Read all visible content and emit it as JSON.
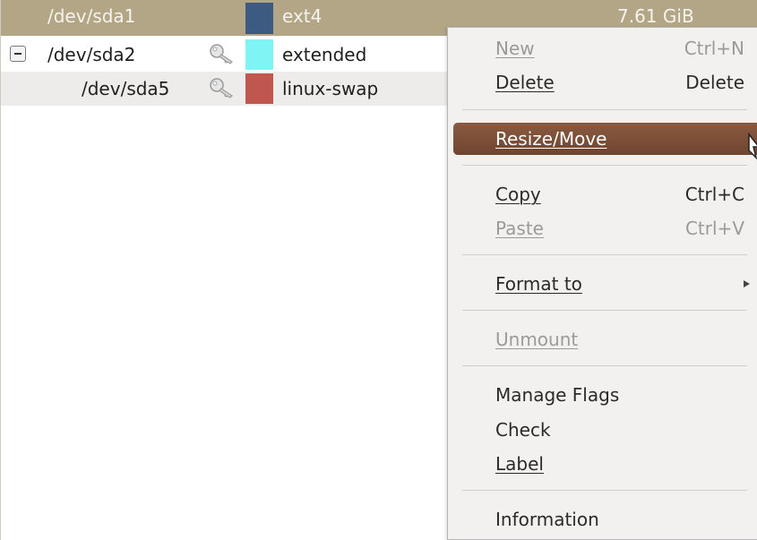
{
  "partitions": [
    {
      "name": "/dev/sda1",
      "filesystem": "ext4",
      "size": "7.61 GiB",
      "color": "#3d5a80",
      "locked": false,
      "selected": true
    },
    {
      "name": "/dev/sda2",
      "filesystem": "extended",
      "color": "#7ef4f4",
      "locked": true,
      "expanded": true
    },
    {
      "name": "/dev/sda5",
      "filesystem": "linux-swap",
      "color": "#c0574e",
      "locked": true
    }
  ],
  "context_menu": {
    "items": {
      "new": {
        "label": "New",
        "accel": "Ctrl+N",
        "enabled": false
      },
      "delete": {
        "label": "Delete",
        "accel": "Delete",
        "enabled": true
      },
      "resize_move": {
        "label": "Resize/Move",
        "enabled": true,
        "highlighted": true
      },
      "copy": {
        "label": "Copy",
        "accel": "Ctrl+C",
        "enabled": true
      },
      "paste": {
        "label": "Paste",
        "accel": "Ctrl+V",
        "enabled": false
      },
      "format_to": {
        "label": "Format to",
        "enabled": true,
        "has_submenu": true
      },
      "unmount": {
        "label": "Unmount",
        "enabled": false
      },
      "manage_flags": {
        "label": "Manage Flags",
        "enabled": true
      },
      "check": {
        "label": "Check",
        "enabled": true
      },
      "label": {
        "label": "Label",
        "enabled": true
      },
      "information": {
        "label": "Information",
        "enabled": true
      }
    }
  },
  "colors": {
    "selected_row": "#b2a687",
    "menu_highlight": "#7b4e37",
    "menu_background": "#f2f1f0"
  }
}
